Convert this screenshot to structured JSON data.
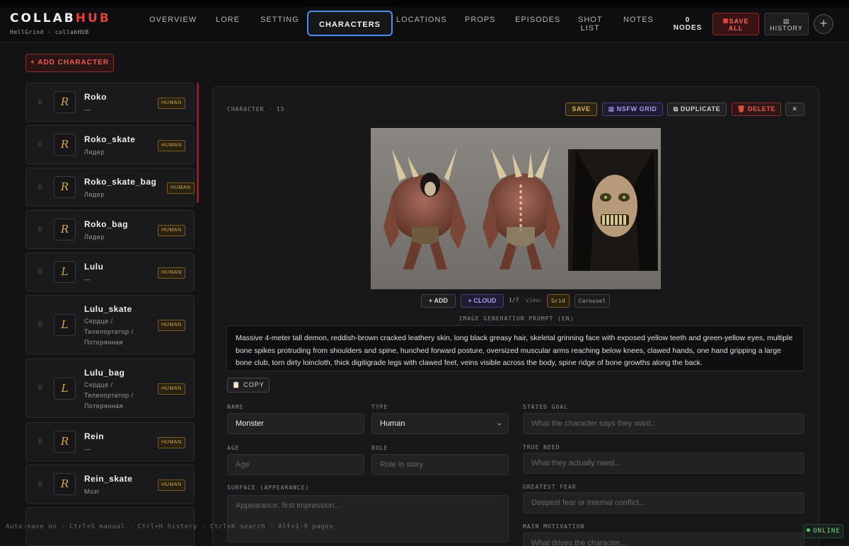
{
  "app": {
    "logo_prefix": "COLLAB",
    "logo_accent": "HUB",
    "subtitle": "HellGrind · collabHUB"
  },
  "nav": {
    "tabs": [
      {
        "label": "OVERVIEW"
      },
      {
        "label": "LORE"
      },
      {
        "label": "SETTING"
      },
      {
        "label": "CHARACTERS",
        "active": true
      },
      {
        "label": "LOCATIONS"
      },
      {
        "label": "PROPS"
      },
      {
        "label": "EPISODES"
      },
      {
        "label_line1": "SHOT",
        "label_line2": "LIST"
      },
      {
        "label": "NOTES"
      }
    ],
    "nodes_count": "0",
    "nodes_label": "NODES",
    "save_all_line1": "SAVE",
    "save_all_line2": "ALL",
    "history_label": "HISTORY",
    "add_icon": "plus-circle-icon"
  },
  "sidebar": {
    "add_button": "+ ADD CHARACTER",
    "characters": [
      {
        "initial": "R",
        "name": "Roko",
        "role": "—",
        "badge": "HUMAN"
      },
      {
        "initial": "R",
        "name": "Roko_skate",
        "role": "Лидер",
        "badge": "HUMAN"
      },
      {
        "initial": "R",
        "name": "Roko_skate_bag",
        "role": "Лидер",
        "badge": "HUMAN"
      },
      {
        "initial": "R",
        "name": "Roko_bag",
        "role": "Лидер",
        "badge": "HUMAN"
      },
      {
        "initial": "L",
        "name": "Lulu",
        "role": "—",
        "badge": "HUMAN"
      },
      {
        "initial": "L",
        "name": "Lulu_skate",
        "role_lines": [
          "Сердце /",
          "Телепортатор /",
          "Потерянная"
        ],
        "badge": "HUMAN"
      },
      {
        "initial": "L",
        "name": "Lulu_bag",
        "role_lines": [
          "Сердце /",
          "Телепортатор /",
          "Потерянная"
        ],
        "badge": "HUMAN"
      },
      {
        "initial": "R",
        "name": "Rein",
        "role": "—",
        "badge": "HUMAN"
      },
      {
        "initial": "R",
        "name": "Rein_skate",
        "role": "Мозг",
        "badge": "HUMAN"
      }
    ]
  },
  "editor": {
    "header": "CHARACTER · 15",
    "buttons": {
      "save": "SAVE",
      "nsfw": "▦ NSFW GRID",
      "duplicate": "⧉ DUPLICATE",
      "delete": "🗑 DELETE",
      "close": "✕"
    },
    "gallery": {
      "add": "+ ADD",
      "cloud": "+ CLOUD",
      "count": "1/7",
      "view_label": "view:",
      "view_grid": "Grid",
      "view_carousel": "Carousel"
    },
    "prompt_label": "IMAGE GENERATION PROMPT (EN)",
    "prompt_text": "Massive 4-meter tall demon, reddish-brown cracked leathery skin, long black greasy hair, skeletal grinning face with exposed yellow teeth and green-yellow eyes, multiple bone spikes protruding from shoulders and spine, hunched forward posture, oversized muscular arms reaching below knees, clawed hands, one hand gripping a large bone club, torn dirty loincloth, thick digitigrade legs with clawed feet, veins visible across the body, spine ridge of bone growths along the back.",
    "copy_button": "📋 COPY",
    "fields": {
      "name_label": "NAME",
      "name_value": "Monster",
      "type_label": "TYPE",
      "type_value": "Human",
      "age_label": "AGE",
      "age_placeholder": "Age",
      "role_label": "ROLE",
      "role_placeholder": "Role in story",
      "surface_label": "SURFACE (APPEARANCE)",
      "surface_placeholder": "Appearance, first impression...",
      "stated_goal_label": "STATED GOAL",
      "stated_goal_placeholder": "What the character says they want...",
      "true_need_label": "TRUE NEED",
      "true_need_placeholder": "What they actually need...",
      "greatest_fear_label": "GREATEST FEAR",
      "greatest_fear_placeholder": "Deepest fear or internal conflict...",
      "main_motivation_label": "MAIN MOTIVATION",
      "main_motivation_placeholder": "What drives the character..."
    }
  },
  "footer": {
    "hint": "Auto-save on · Ctrl+S manual · Ctrl+H history · Ctrl+K search · Alt+1-9 pages",
    "status": "ONLINE"
  },
  "colors": {
    "accent_red": "#e0413a",
    "active_tab_border": "#4c8ff0",
    "badge_gold": "#d3a64a",
    "online_green": "#4ad167"
  }
}
